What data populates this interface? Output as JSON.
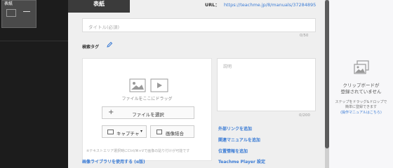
{
  "sidebar": {
    "step_label": "表紙"
  },
  "editor": {
    "tab_label": "表紙",
    "url_label": "URL：",
    "url_value": "https://teachme.jp/8/manuals/37284895",
    "title_placeholder": "タイトル(必須)",
    "title_count": "0/50",
    "tags_label": "検索タグ",
    "drop_text": "ファイルをここにドラッグ",
    "select_file_label": "ファイルを選択",
    "capture_label": "キャプチャ",
    "merge_label": "画像結合",
    "hint_text": "※テキストエリア選択時にCtrl/⌘+Vで画像の貼り付けが可能です",
    "library_link": "画像ライブラリを使用する (α版)",
    "description_placeholder": "説明",
    "description_count": "0/200",
    "actions": [
      "外部リンクを追加",
      "関連マニュアルを追加",
      "位置情報を追加",
      "Teachme Player 設定"
    ]
  },
  "clipboard": {
    "title_line1": "クリップボードが",
    "title_line2": "登録されていません",
    "sub_line1": "ステップをドラッグ&ドロップで",
    "sub_line2": "簡単に登録できます",
    "link": "(操作マニュアルはこちら)"
  },
  "colors": {
    "accent": "#3a7bd5",
    "sidebar_bg": "#1c1c1c",
    "tab_bg": "#3b3b3b"
  }
}
